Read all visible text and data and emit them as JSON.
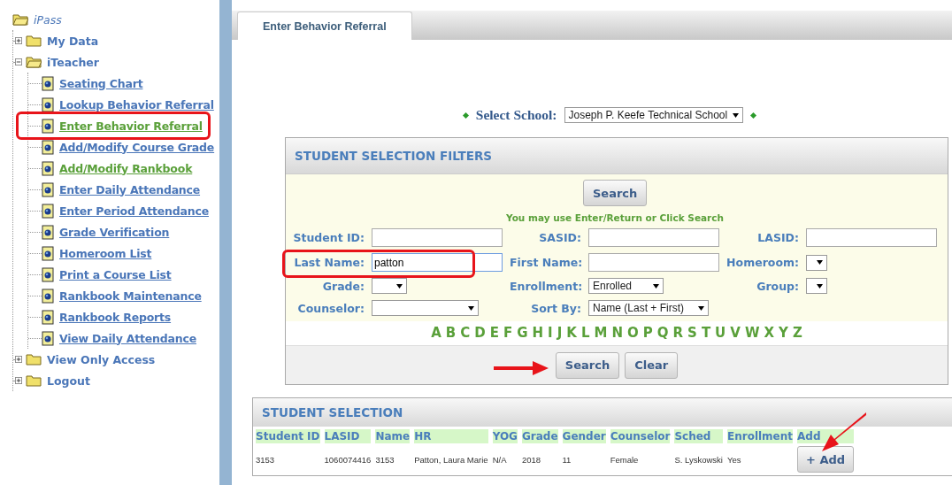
{
  "sidebar": {
    "tree": [
      {
        "label": "iPass",
        "kind": "root",
        "expanded": true,
        "children": [
          {
            "label": "My Data",
            "kind": "folder",
            "expanded": false
          },
          {
            "label": "iTeacher",
            "kind": "folder",
            "expanded": true,
            "children": [
              {
                "label": "Seating Chart",
                "kind": "page",
                "visited": false,
                "highlighted": false
              },
              {
                "label": "Lookup Behavior Referral",
                "kind": "page",
                "visited": false,
                "highlighted": false
              },
              {
                "label": "Enter Behavior Referral",
                "kind": "page",
                "visited": true,
                "highlighted": true
              },
              {
                "label": "Add/Modify Course Grade",
                "kind": "page",
                "visited": false,
                "highlighted": false
              },
              {
                "label": "Add/Modify Rankbook",
                "kind": "page",
                "visited": true,
                "highlighted": false
              },
              {
                "label": "Enter Daily Attendance",
                "kind": "page",
                "visited": false,
                "highlighted": false
              },
              {
                "label": "Enter Period Attendance",
                "kind": "page",
                "visited": false,
                "highlighted": false
              },
              {
                "label": "Grade Verification",
                "kind": "page",
                "visited": false,
                "highlighted": false
              },
              {
                "label": "Homeroom List",
                "kind": "page",
                "visited": false,
                "highlighted": false
              },
              {
                "label": "Print a Course List",
                "kind": "page",
                "visited": false,
                "highlighted": false
              },
              {
                "label": "Rankbook Maintenance",
                "kind": "page",
                "visited": false,
                "highlighted": false
              },
              {
                "label": "Rankbook Reports",
                "kind": "page",
                "visited": false,
                "highlighted": false
              },
              {
                "label": "View Daily Attendance",
                "kind": "page",
                "visited": false,
                "highlighted": false
              }
            ]
          },
          {
            "label": "View Only Access",
            "kind": "folder",
            "expanded": false
          },
          {
            "label": "Logout",
            "kind": "folder",
            "expanded": false
          }
        ]
      }
    ]
  },
  "tabs": [
    {
      "label": "Enter Behavior Referral",
      "selected": true
    }
  ],
  "select_school": {
    "label": "Select School:",
    "value": "Joseph P. Keefe Technical School"
  },
  "filters": {
    "title": "STUDENT SELECTION FILTERS",
    "top_button": "Search",
    "hint": "You may use Enter/Return or Click Search",
    "fields": [
      {
        "label": "Student ID:",
        "kind": "text",
        "highlighted": false
      },
      {
        "label": "SASID:",
        "kind": "text",
        "highlighted": false
      },
      {
        "label": "LASID:",
        "kind": "text",
        "highlighted": false
      },
      {
        "label": "Last Name:",
        "kind": "text",
        "value": "patton",
        "highlighted": true
      },
      {
        "label": "First Name:",
        "kind": "text",
        "highlighted": false
      },
      {
        "label": "Homeroom:",
        "kind": "dropdown",
        "highlighted": false
      },
      {
        "label": "Grade:",
        "kind": "dropdown",
        "highlighted": false
      },
      {
        "label": "Enrollment:",
        "kind": "dropdown",
        "value": "Enrolled",
        "highlighted": false
      },
      {
        "label": "Group:",
        "kind": "dropdown",
        "highlighted": false
      },
      {
        "label": "Counselor:",
        "kind": "dropdown",
        "highlighted": false
      },
      {
        "label": "Sort By:",
        "kind": "dropdown",
        "value": "Name (Last + First)",
        "highlighted": false
      }
    ],
    "letters": [
      "A",
      "B",
      "C",
      "D",
      "E",
      "F",
      "G",
      "H",
      "I",
      "J",
      "K",
      "L",
      "M",
      "N",
      "O",
      "P",
      "Q",
      "R",
      "S",
      "T",
      "U",
      "V",
      "W",
      "X",
      "Y",
      "Z"
    ],
    "buttons": [
      {
        "label": "Search",
        "arrow": true
      },
      {
        "label": "Clear",
        "arrow": false
      }
    ]
  },
  "results": {
    "title": "STUDENT SELECTION",
    "columns": [
      "Student ID",
      "LASID",
      "Name",
      "HR",
      "YOG",
      "Grade",
      "Gender",
      "Counselor",
      "Sched",
      "Enrollment",
      "Add"
    ],
    "rows": [
      {
        "cells": [
          "3153",
          "1060074416",
          "3153",
          "Patton, Laura Marie",
          "N/A",
          "2018",
          "11",
          "Female",
          "S. Lyskowski",
          "Yes"
        ],
        "action": {
          "label": "+ Add",
          "arrow": true
        }
      }
    ]
  }
}
